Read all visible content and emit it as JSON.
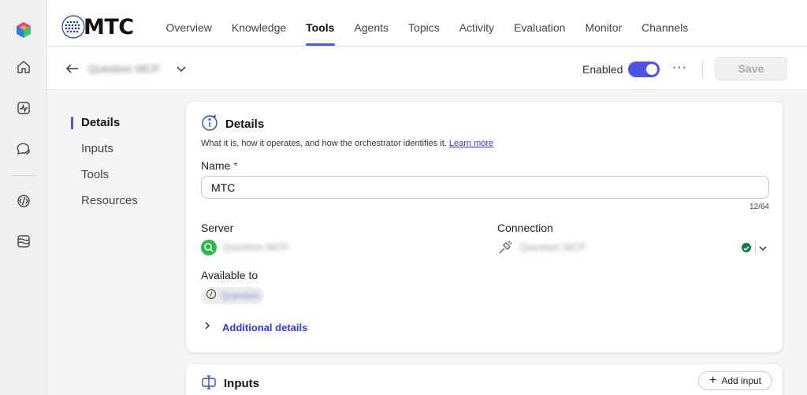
{
  "brand": {
    "logo_text": "MTC"
  },
  "nav": {
    "tabs": [
      {
        "label": "Overview"
      },
      {
        "label": "Knowledge"
      },
      {
        "label": "Tools",
        "active": true
      },
      {
        "label": "Agents"
      },
      {
        "label": "Topics"
      },
      {
        "label": "Activity"
      },
      {
        "label": "Evaluation"
      },
      {
        "label": "Monitor"
      },
      {
        "label": "Channels"
      }
    ]
  },
  "rail": {
    "icons": [
      "copilot-studio-logo-icon",
      "home-icon",
      "activity-icon",
      "chat-icon",
      "code-icon",
      "waves-icon"
    ]
  },
  "header": {
    "agent_name": "Question MCP",
    "enabled_label": "Enabled",
    "enabled": true,
    "more_label": "···",
    "save_label": "Save"
  },
  "section_nav": {
    "items": [
      {
        "label": "Details",
        "active": true
      },
      {
        "label": "Inputs"
      },
      {
        "label": "Tools"
      },
      {
        "label": "Resources"
      }
    ]
  },
  "details": {
    "title": "Details",
    "description": "What it is, how it operates, and how the orchestrator identifies it.",
    "learn_more": "Learn more",
    "name_label": "Name",
    "required_mark": "*",
    "name_value": "MTC",
    "name_count": "12/64",
    "server_label": "Server",
    "server_name": "Question MCP",
    "connection_label": "Connection",
    "connection_name": "Question MCP",
    "available_label": "Available to",
    "available_chip": "Question",
    "additional_details": "Additional details"
  },
  "inputs": {
    "title": "Inputs",
    "add_input_label": "Add input"
  },
  "colors": {
    "accent": "#4f52e6",
    "link": "#2f3bd6",
    "server_green": "#2db64a",
    "status_green": "#107c41"
  }
}
